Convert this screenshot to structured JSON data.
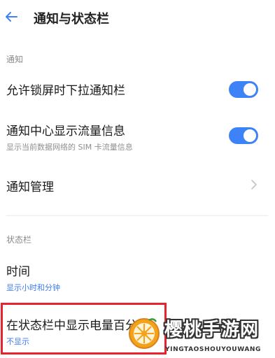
{
  "header": {
    "title": "通知与状态栏",
    "back_icon": "back-arrow-icon"
  },
  "notification": {
    "section_label": "通知",
    "items": [
      {
        "title": "允许锁屏时下拉通知栏",
        "toggle": true
      },
      {
        "title": "通知中心显示流量信息",
        "subtitle": "显示当前数据网络的 SIM 卡流量信息",
        "toggle": true
      },
      {
        "title": "通知管理",
        "icon": "chevron-right-icon"
      }
    ]
  },
  "status_bar": {
    "section_label": "状态栏",
    "items": [
      {
        "title": "时间",
        "subtitle": "显示小时和分钟"
      },
      {
        "title": "在状态栏中显示电量百分比",
        "subtitle": "不显示"
      }
    ]
  },
  "watermark": {
    "title": "樱桃手游网",
    "subtitle": "YINGTAOSHOUYOUWANG"
  },
  "colors": {
    "accent": "#3e82f7",
    "highlight": "#e8232e"
  }
}
